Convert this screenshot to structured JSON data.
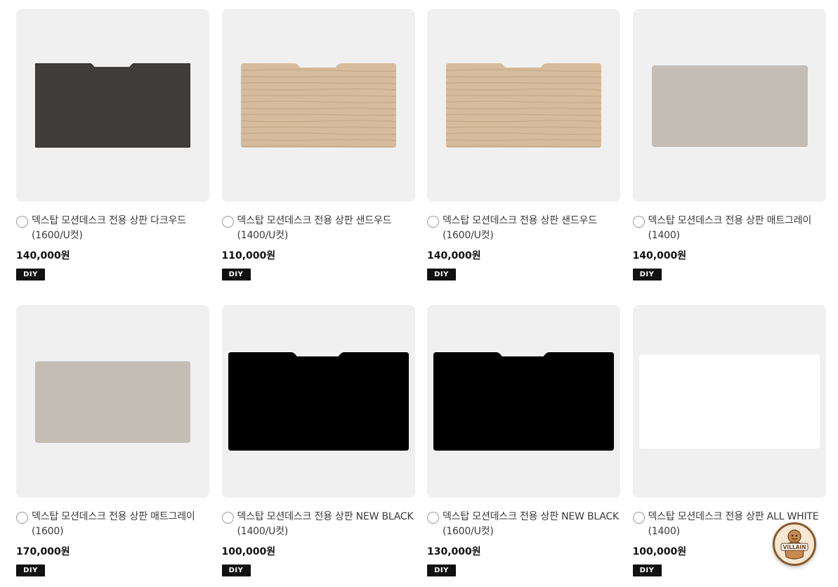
{
  "products": [
    {
      "name": "덱스탑 모션데스크 전용 상판 다크우드 (1600/U컷)",
      "price": "140,000원",
      "badge": "DIY",
      "finish": "dark",
      "color": "#413d3b",
      "notch": true
    },
    {
      "name": "덱스탑 모션데스크 전용 상판 샌드우드 (1400/U컷)",
      "price": "110,000원",
      "badge": "DIY",
      "finish": "wood",
      "color": "#d6bc9c",
      "notch": true
    },
    {
      "name": "덱스탑 모션데스크 전용 상판 샌드우드 (1600/U컷)",
      "price": "140,000원",
      "badge": "DIY",
      "finish": "wood",
      "color": "#d6bc9c",
      "notch": true
    },
    {
      "name": "덱스탑 모션데스크 전용 상판 매트그레이 (1400)",
      "price": "140,000원",
      "badge": "DIY",
      "finish": "gray",
      "color": "#c3bdb6",
      "notch": false
    },
    {
      "name": "덱스탑 모션데스크 전용 상판 매트그레이 (1600)",
      "price": "170,000원",
      "badge": "DIY",
      "finish": "gray",
      "color": "#c3bdb6",
      "notch": false
    },
    {
      "name": "덱스탑 모션데스크 전용 상판 NEW BLACK (1400/U컷)",
      "price": "100,000원",
      "badge": "DIY",
      "finish": "black",
      "color": "#000000",
      "notch": true
    },
    {
      "name": "덱스탑 모션데스크 전용 상판 NEW BLACK (1600/U컷)",
      "price": "130,000원",
      "badge": "DIY",
      "finish": "black",
      "color": "#000000",
      "notch": true
    },
    {
      "name": "덱스탑 모션데스크 전용 상판 ALL WHITE (1400)",
      "price": "100,000원",
      "badge": "DIY",
      "finish": "white",
      "color": "#ffffff",
      "notch": false
    }
  ],
  "floating_button": {
    "label": "VILLAIN",
    "icon": "villain-mascot-icon"
  },
  "colors": {
    "thumb_bg": "#f0f0f0",
    "badge_bg": "#111111",
    "wood_grain": "#b89a78"
  }
}
